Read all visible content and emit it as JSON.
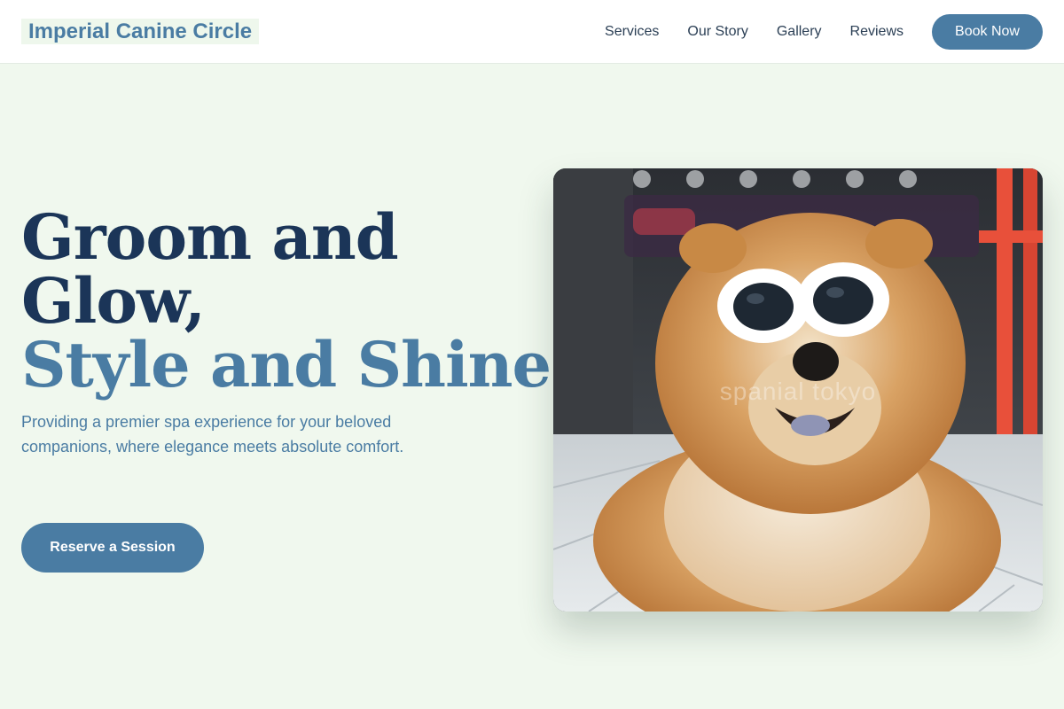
{
  "header": {
    "logo": "Imperial Canine Circle",
    "nav": [
      "Services",
      "Our Story",
      "Gallery",
      "Reviews"
    ],
    "cta": "Book Now"
  },
  "hero": {
    "title_line1": "Groom and",
    "title_line2": "Glow,",
    "title_line3": "Style and Shine.",
    "subtitle": "Providing a premier spa experience for your beloved companions, where elegance meets absolute comfort.",
    "cta": "Reserve a Session",
    "image_watermark": "spanial tokyo"
  },
  "colors": {
    "accent": "#4a7ca3",
    "heading": "#1b3558",
    "background": "#f0f8ee",
    "header_bg": "#ffffff"
  }
}
